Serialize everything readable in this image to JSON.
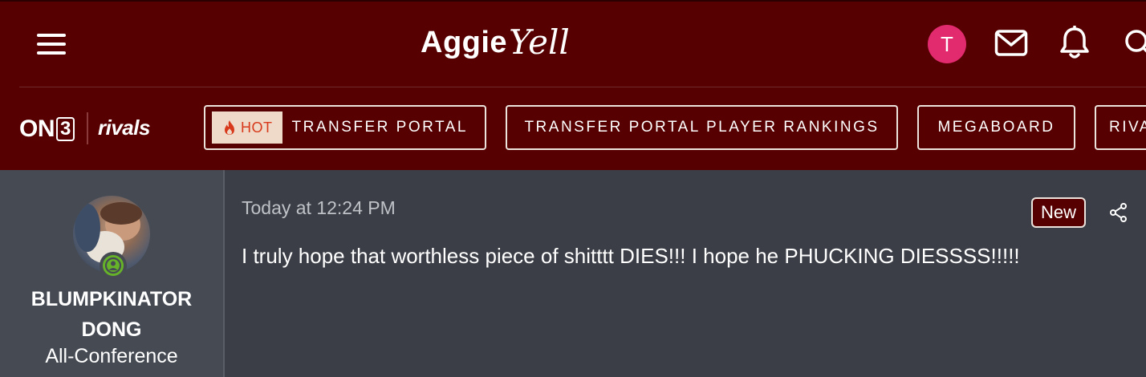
{
  "header": {
    "logo_part1": "Aggie",
    "logo_part2": "Yell",
    "user_initial": "T"
  },
  "brand": {
    "on3_prefix": "ON",
    "on3_number": "3",
    "rivals": "rivals"
  },
  "nav": {
    "hot_label": "HOT",
    "items": [
      {
        "label": "TRANSFER PORTAL"
      },
      {
        "label": "TRANSFER PORTAL PLAYER RANKINGS"
      },
      {
        "label": "MEGABOARD"
      },
      {
        "label": "RIVALS"
      }
    ]
  },
  "post": {
    "username_line1": "BLUMPKINATOR",
    "username_line2": "DONG",
    "user_title": "All-Conference",
    "timestamp": "Today at 12:24 PM",
    "badge": "New",
    "text": "I truly hope that worthless piece of shitttt DIES!!! I hope he PHUCKING DIESSSS!!!!!"
  },
  "colors": {
    "header_bg": "#560001",
    "page_bg": "#3b3e46",
    "user_col_bg": "#454a53",
    "avatar_bg": "#e22a6e",
    "online": "#66b32a",
    "hot_text": "#d7391a"
  },
  "icons": [
    "menu-icon",
    "mail-icon",
    "bell-icon",
    "search-icon",
    "flame-icon",
    "share-icon",
    "online-status-icon"
  ]
}
